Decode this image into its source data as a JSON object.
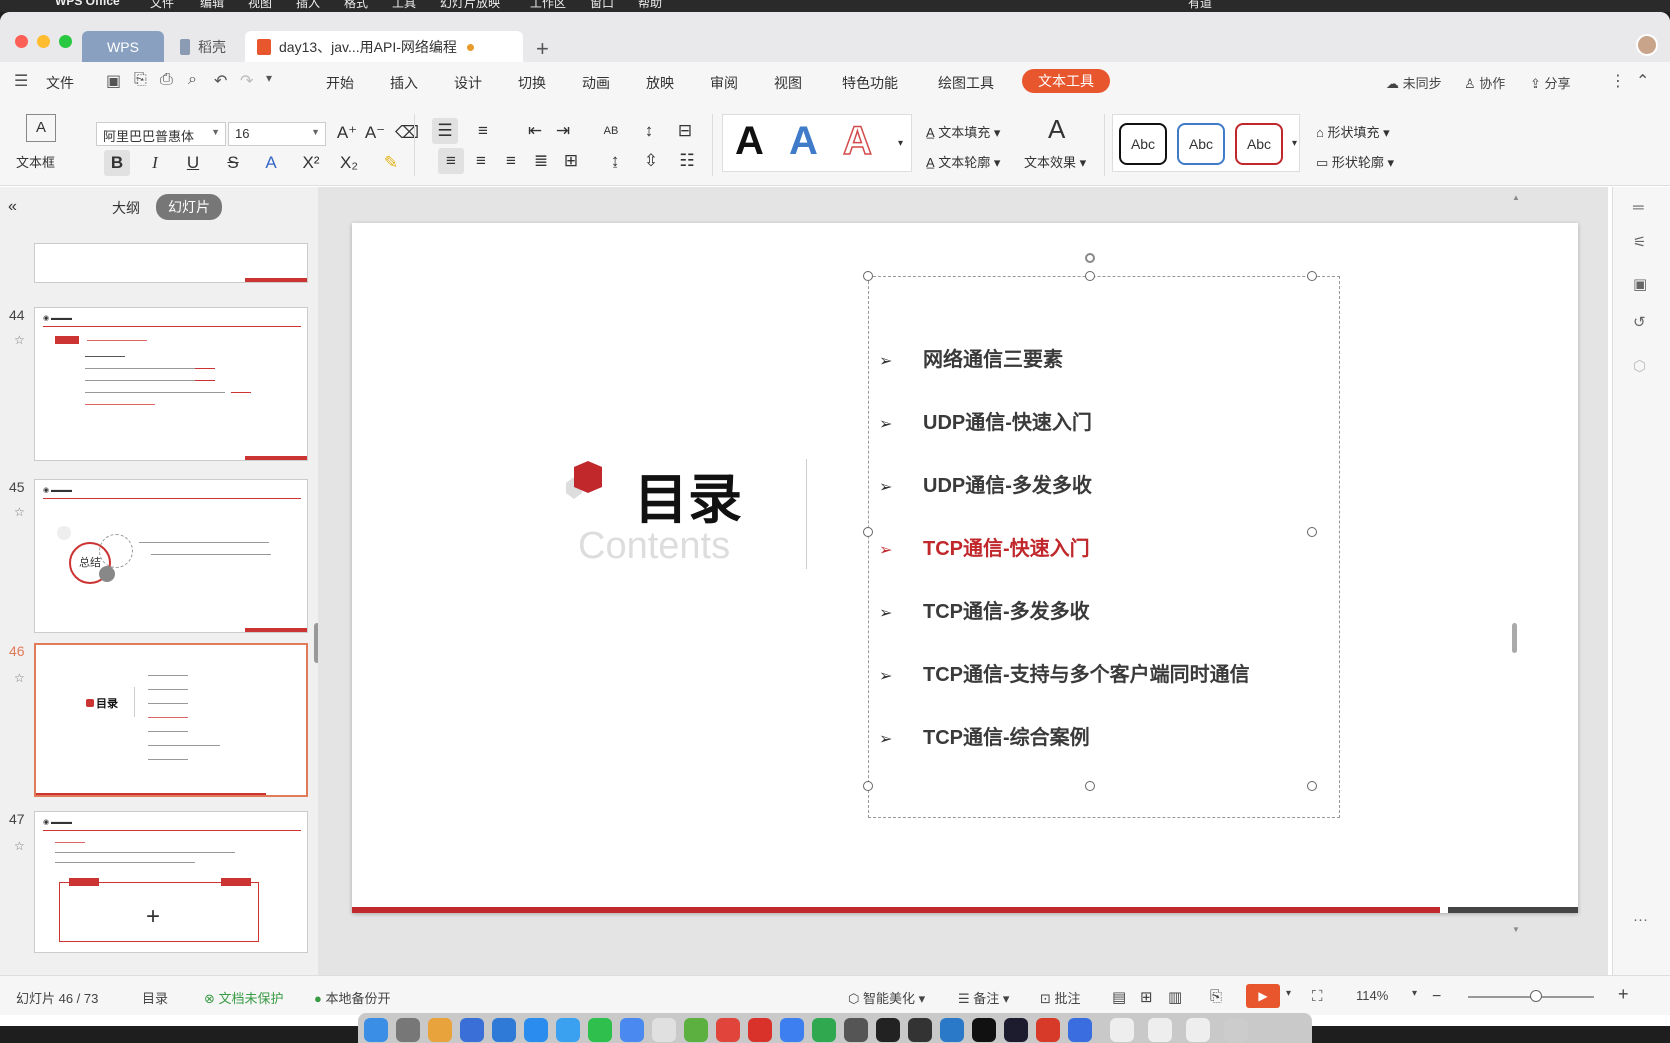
{
  "menubar": {
    "items": [
      "WPS Office",
      "文件",
      "编辑",
      "视图",
      "插入",
      "格式",
      "工具",
      "幻灯片放映",
      "工作区",
      "窗口",
      "帮助"
    ],
    "right": [
      "有道"
    ]
  },
  "tabs": {
    "wps": "WPS",
    "home": "稻壳",
    "doc": "day13、jav...用API-网络编程"
  },
  "menu": {
    "file": "文件",
    "items": [
      "开始",
      "插入",
      "设计",
      "切换",
      "动画",
      "放映",
      "审阅",
      "视图",
      "特色功能",
      "绘图工具"
    ],
    "active": "文本工具",
    "sync": "未同步",
    "collab": "协作",
    "share": "分享"
  },
  "ribbon": {
    "textbox_label": "文本框",
    "font": "阿里巴巴普惠体",
    "size": "16",
    "fill": "文本填充",
    "outline": "文本轮廓",
    "effect": "文本效果",
    "shape_fill": "形状填充",
    "shape_outline": "形状轮廓",
    "abc": [
      "Abc",
      "Abc",
      "Abc"
    ],
    "wordart": [
      "A",
      "A",
      "A"
    ]
  },
  "leftpanel": {
    "tab_outline": "大纲",
    "tab_slides": "幻灯片",
    "slide_numbers": [
      "44",
      "45",
      "46",
      "47"
    ],
    "summary": "总结",
    "mini_title": "目录"
  },
  "slide": {
    "title_cn": "目录",
    "title_en": "Contents",
    "items": [
      "网络通信三要素",
      "UDP通信-快速入门",
      "UDP通信-多发多收",
      "TCP通信-快速入门",
      "TCP通信-多发多收",
      "TCP通信-支持与多个客户端同时通信",
      "TCP通信-综合案例"
    ],
    "highlight_index": 3
  },
  "status": {
    "slide_pos": "幻灯片 46 / 73",
    "section": "目录",
    "unprotected": "文档未保护",
    "backup": "本地备份开",
    "beautify": "智能美化",
    "notes": "备注",
    "comment": "批注",
    "zoom": "114%"
  },
  "colors": {
    "accent": "#e8562e",
    "slide_red": "#c0282c",
    "green": "#3a9b45"
  }
}
